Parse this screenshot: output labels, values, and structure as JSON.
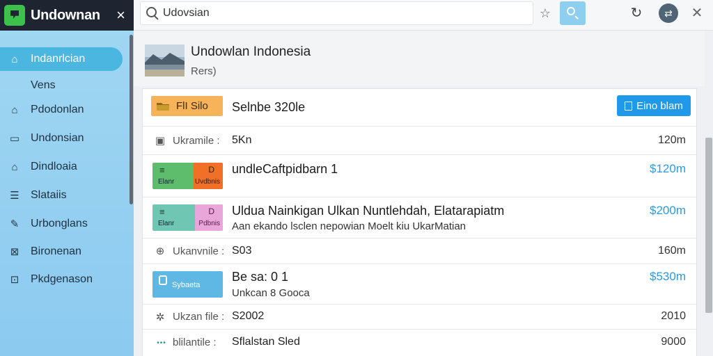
{
  "brand": {
    "title": "Undownan"
  },
  "search": {
    "value": "Udovsian",
    "placeholder": ""
  },
  "sidebar": {
    "items": [
      {
        "label": "Indanrlcian",
        "icon": "home-icon"
      },
      {
        "label": "Pdodonlan",
        "icon": "house-icon"
      },
      {
        "label": "Undonsian",
        "icon": "window-icon"
      },
      {
        "label": "Dindloaia",
        "icon": "building-icon"
      },
      {
        "label": "Slataiis",
        "icon": "list-icon"
      },
      {
        "label": "Urbonglans",
        "icon": "wrench-icon"
      },
      {
        "label": "Bironenan",
        "icon": "close-box-icon"
      },
      {
        "label": "Pkdgenason",
        "icon": "lock-icon"
      }
    ],
    "sub_label": "Vens"
  },
  "header": {
    "title": "Undowlan Indonesia",
    "subtitle": "Rers)"
  },
  "panel": {
    "tag_label": "FlΙ Silo",
    "title": "Selnbe 320le",
    "primary_button": "Eino blam"
  },
  "rows": [
    {
      "type": "meta",
      "label": "Ukramile :",
      "value": "5Kn",
      "right": "120m"
    },
    {
      "type": "item",
      "title": "undleCaftpidbarn 1",
      "desc": "",
      "price": "$120m",
      "tag_left": "Elanr",
      "tag_right": "Uvdbnis",
      "left_glyph": "≡",
      "right_glyph": "D"
    },
    {
      "type": "item",
      "title": "Uldua Nainkigan Ulkan Nuntlehdah, Elatarapiatm",
      "desc": "Aan ekando lsclen nepowian Moelt kiu UkarMatian",
      "price": "$200m",
      "tag_left": "Elanr",
      "tag_right": "Pdbnis",
      "left_glyph": "≡",
      "right_glyph": "D"
    },
    {
      "type": "meta",
      "label": "Ukanvnile :",
      "value": "S03",
      "right": "160m"
    },
    {
      "type": "item",
      "title": "Be sa: 0 1",
      "desc": "Unkcan 8 Gooca",
      "price": "$530m",
      "tag_single": "Sybaeta"
    },
    {
      "type": "meta",
      "label": "Ukzan file :",
      "value": "S2002",
      "right": "2010"
    },
    {
      "type": "meta",
      "label": "blilantile :",
      "value": "Sflalstan Sled",
      "right": "9000"
    }
  ],
  "colors": {
    "accent": "#2199ea",
    "price": "#2a9be0",
    "tag": "#f6b35a",
    "sidebar": "#9fd6f2"
  }
}
